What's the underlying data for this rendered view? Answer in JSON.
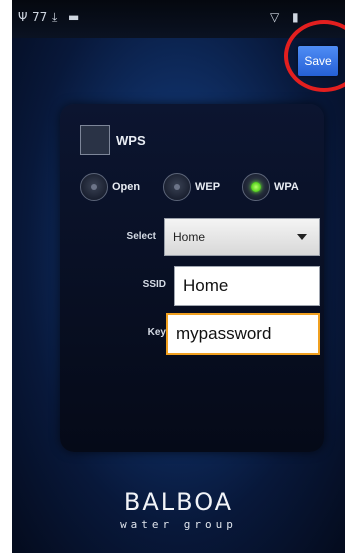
{
  "status_bar": {
    "left_icons": [
      "usb-icon",
      "temperature-icon",
      "download-icon",
      "chat-icon"
    ],
    "temperature": "77",
    "right_icons": [
      "wifi-icon",
      "battery-icon"
    ]
  },
  "toolbar": {
    "save_label": "Save",
    "highlight_color": "#e31f1f"
  },
  "form": {
    "wps_label": "WPS",
    "wps_checked": false,
    "security_options": [
      {
        "label": "Open",
        "selected": false
      },
      {
        "label": "WEP",
        "selected": false
      },
      {
        "label": "WPA",
        "selected": true
      }
    ],
    "select_label": "Select",
    "select_value": "Home",
    "ssid_label": "SSID",
    "ssid_value": "Home",
    "key_label": "Key",
    "key_value": "mypassword"
  },
  "branding": {
    "logo": "BALBOA",
    "tagline": "water group"
  }
}
